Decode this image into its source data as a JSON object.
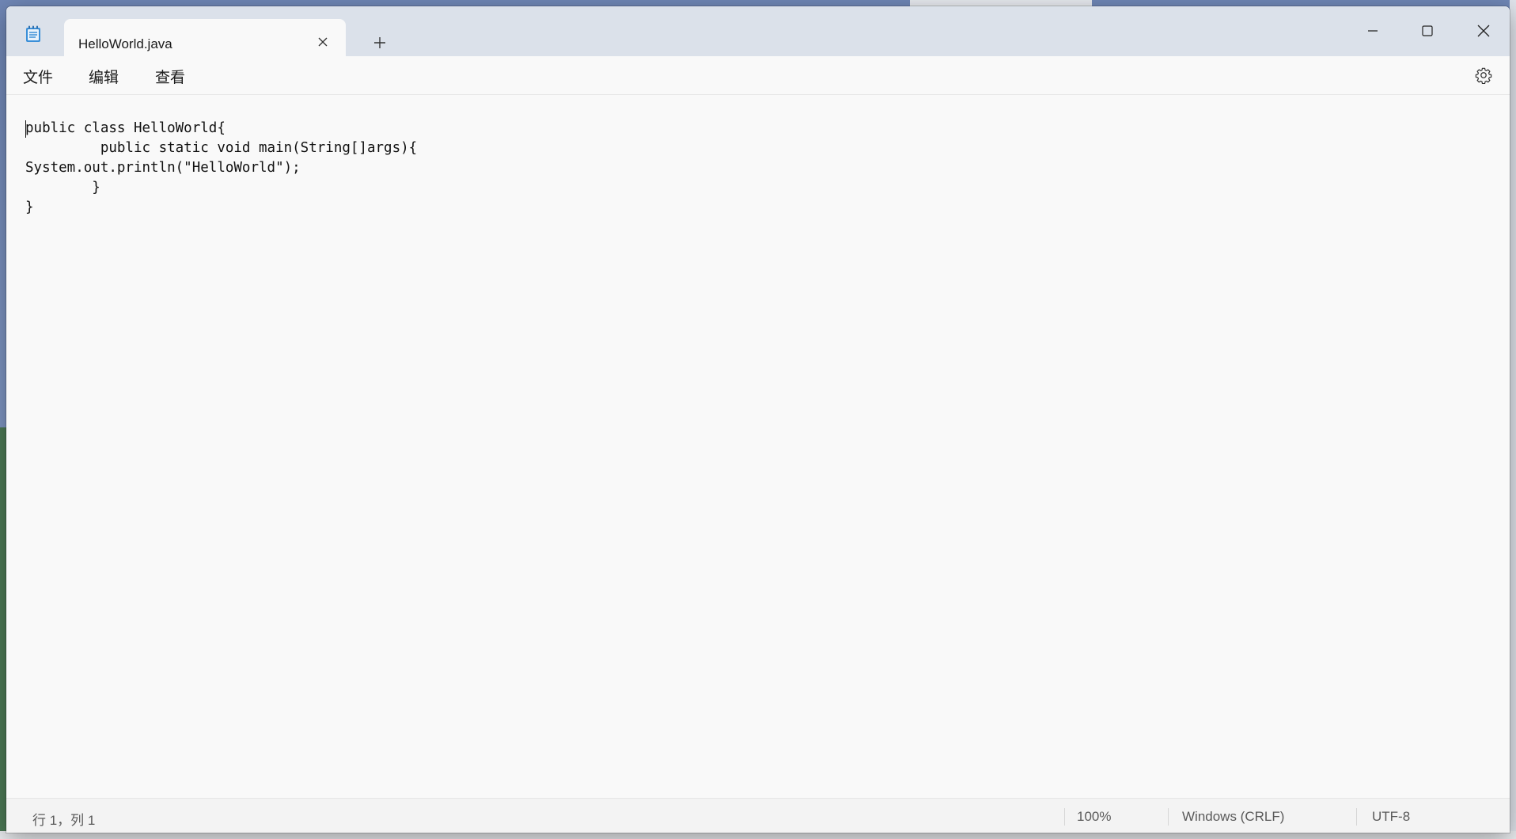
{
  "window": {
    "tab_title": "HelloWorld.java"
  },
  "icons": {
    "app": "notepad-icon",
    "tab_close": "close-icon",
    "new_tab": "plus-icon",
    "minimize": "minimize-icon",
    "maximize": "maximize-icon",
    "close": "close-icon",
    "settings": "gear-icon"
  },
  "menu": {
    "file": "文件",
    "edit": "编辑",
    "view": "查看"
  },
  "editor": {
    "content": "public class HelloWorld{\n         public static void main(String[]args){\nSystem.out.println(\"HelloWorld\");\n        }\n}"
  },
  "status": {
    "position": "行 1，列 1",
    "zoom": "100%",
    "line_ending": "Windows (CRLF)",
    "encoding": "UTF-8"
  },
  "colors": {
    "titlebar": "#dbe1ea",
    "editor_bg": "#f9f9f9",
    "statusbar": "#f3f3f3"
  }
}
